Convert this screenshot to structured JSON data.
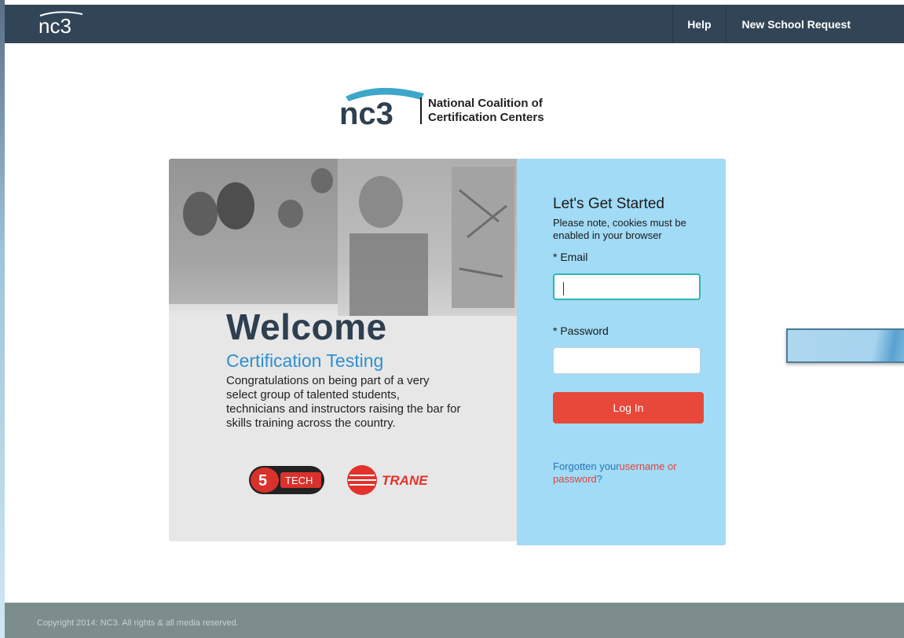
{
  "header": {
    "brand_text": "nc3",
    "nav": [
      {
        "label": "Help"
      },
      {
        "label": "New School Request"
      }
    ]
  },
  "logo": {
    "mark_text": "nc3",
    "name_line1": "National Coalition of",
    "name_line2": "Certification Centers"
  },
  "welcome": {
    "heading": "Welcome",
    "subheading": "Certification Testing",
    "body": "Congratulations on being part of a very select group of talented students, technicians and instructors raising the bar for skills training across the country.",
    "partners": [
      {
        "name": "snap-on-tech-logo",
        "text": "TECH"
      },
      {
        "name": "trane-logo",
        "text": "TRANE"
      }
    ]
  },
  "login": {
    "title": "Let's Get Started",
    "note": "Please note, cookies must be enabled in your browser",
    "email_label": "* Email",
    "email_value": "",
    "password_label": "* Password",
    "password_value": "",
    "submit_label": "Log In",
    "forgot_prefix": "Forgotten your",
    "forgot_link": "username or password",
    "forgot_suffix": "?"
  },
  "footer": {
    "copyright": "Copyright 2014: NC3. All rights & all media reserved."
  },
  "colors": {
    "header_bg": "#324557",
    "form_panel": "#a1dbf6",
    "login_button": "#e8483a",
    "accent_blue": "#2f8fd0",
    "footer_bg": "#7d8d8d"
  }
}
